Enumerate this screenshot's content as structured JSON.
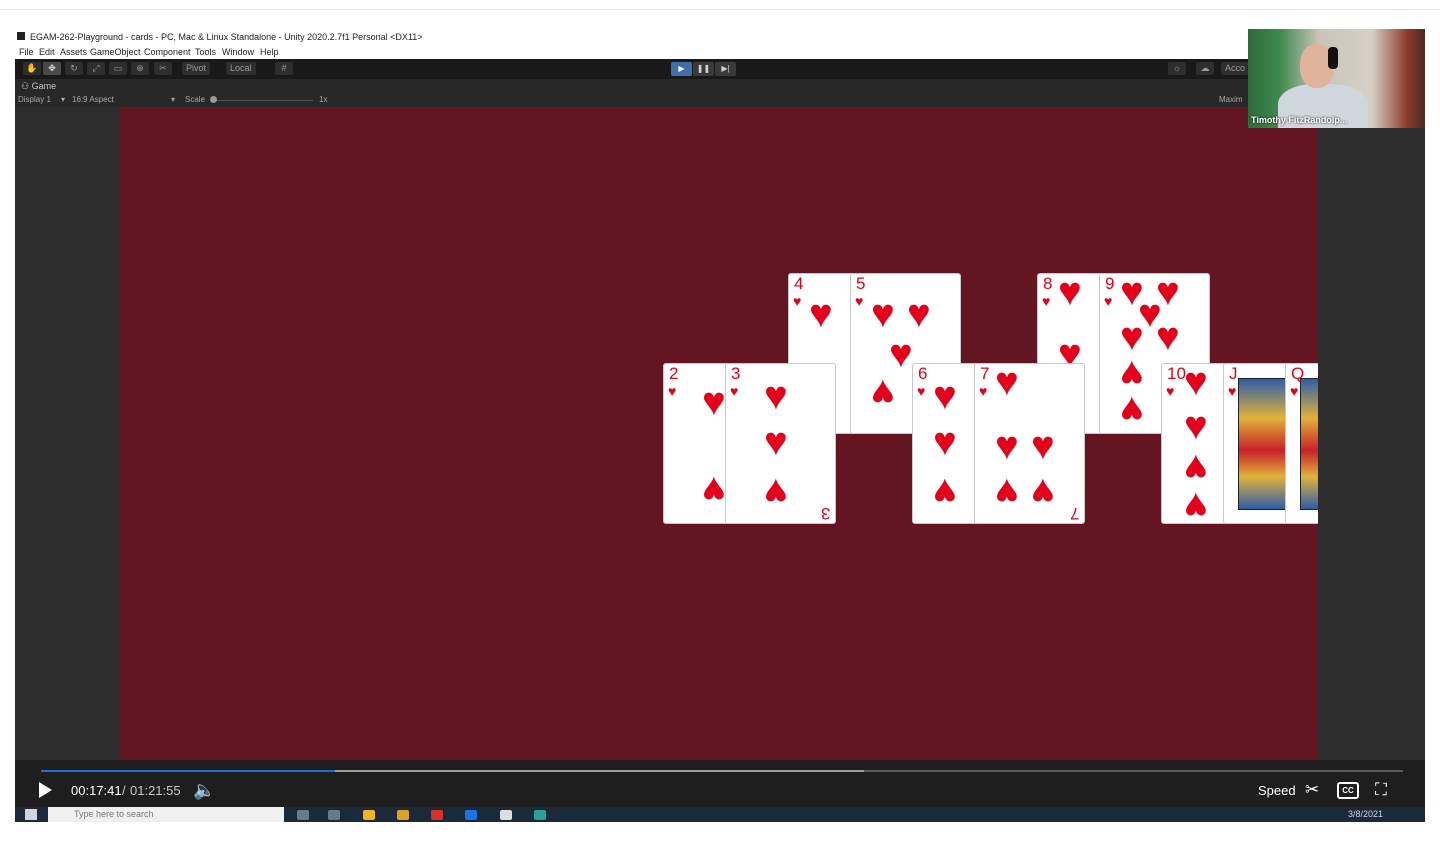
{
  "unity": {
    "window_title": "EGAM-262-Playground - cards - PC, Mac & Linux Standalone - Unity 2020.2.7f1 Personal <DX11>",
    "menu": [
      "File",
      "Edit",
      "Assets",
      "GameObject",
      "Component",
      "Tools",
      "Window",
      "Help"
    ],
    "toolbar": {
      "pivot_label": "Pivot",
      "local_label": "Local",
      "account_label": "Acco"
    },
    "game_tab": {
      "label": "Game",
      "display": "Display 1",
      "aspect": "16:9 Aspect",
      "scale_label": "Scale",
      "scale_value": "1x",
      "maximize_label": "Maxim"
    }
  },
  "cards_row_top": [
    {
      "rank": "4"
    },
    {
      "rank": "5"
    },
    {
      "rank": "8"
    },
    {
      "rank": "9"
    }
  ],
  "cards_row_bottom": [
    {
      "rank": "2",
      "bottom": ""
    },
    {
      "rank": "3",
      "bottom": "3"
    },
    {
      "rank": "6",
      "bottom": ""
    },
    {
      "rank": "7",
      "bottom": "7"
    },
    {
      "rank": "10",
      "bottom": ""
    },
    {
      "rank": "J",
      "bottom": ""
    },
    {
      "rank": "Q",
      "bottom": ""
    }
  ],
  "suit_symbol": "♥",
  "colors": {
    "felt": "#631522",
    "heart": "#e4001b",
    "progress": "#1f6fd0"
  },
  "webcam": {
    "name": "Timothy FitzRandolp..."
  },
  "player": {
    "current_time": "00:17:41",
    "separator": "/",
    "total_time": "01:21:55",
    "progress_fraction": 0.216,
    "buffered_fraction": 0.604,
    "speed_label": "Speed",
    "cc_label": "CC",
    "icons": {
      "play": "play-icon",
      "volume": "volume-icon",
      "clip": "scissors-icon",
      "fullscreen": "fullscreen-icon"
    }
  },
  "taskbar": {
    "search_placeholder": "Type here to search",
    "date": "3/8/2021"
  }
}
